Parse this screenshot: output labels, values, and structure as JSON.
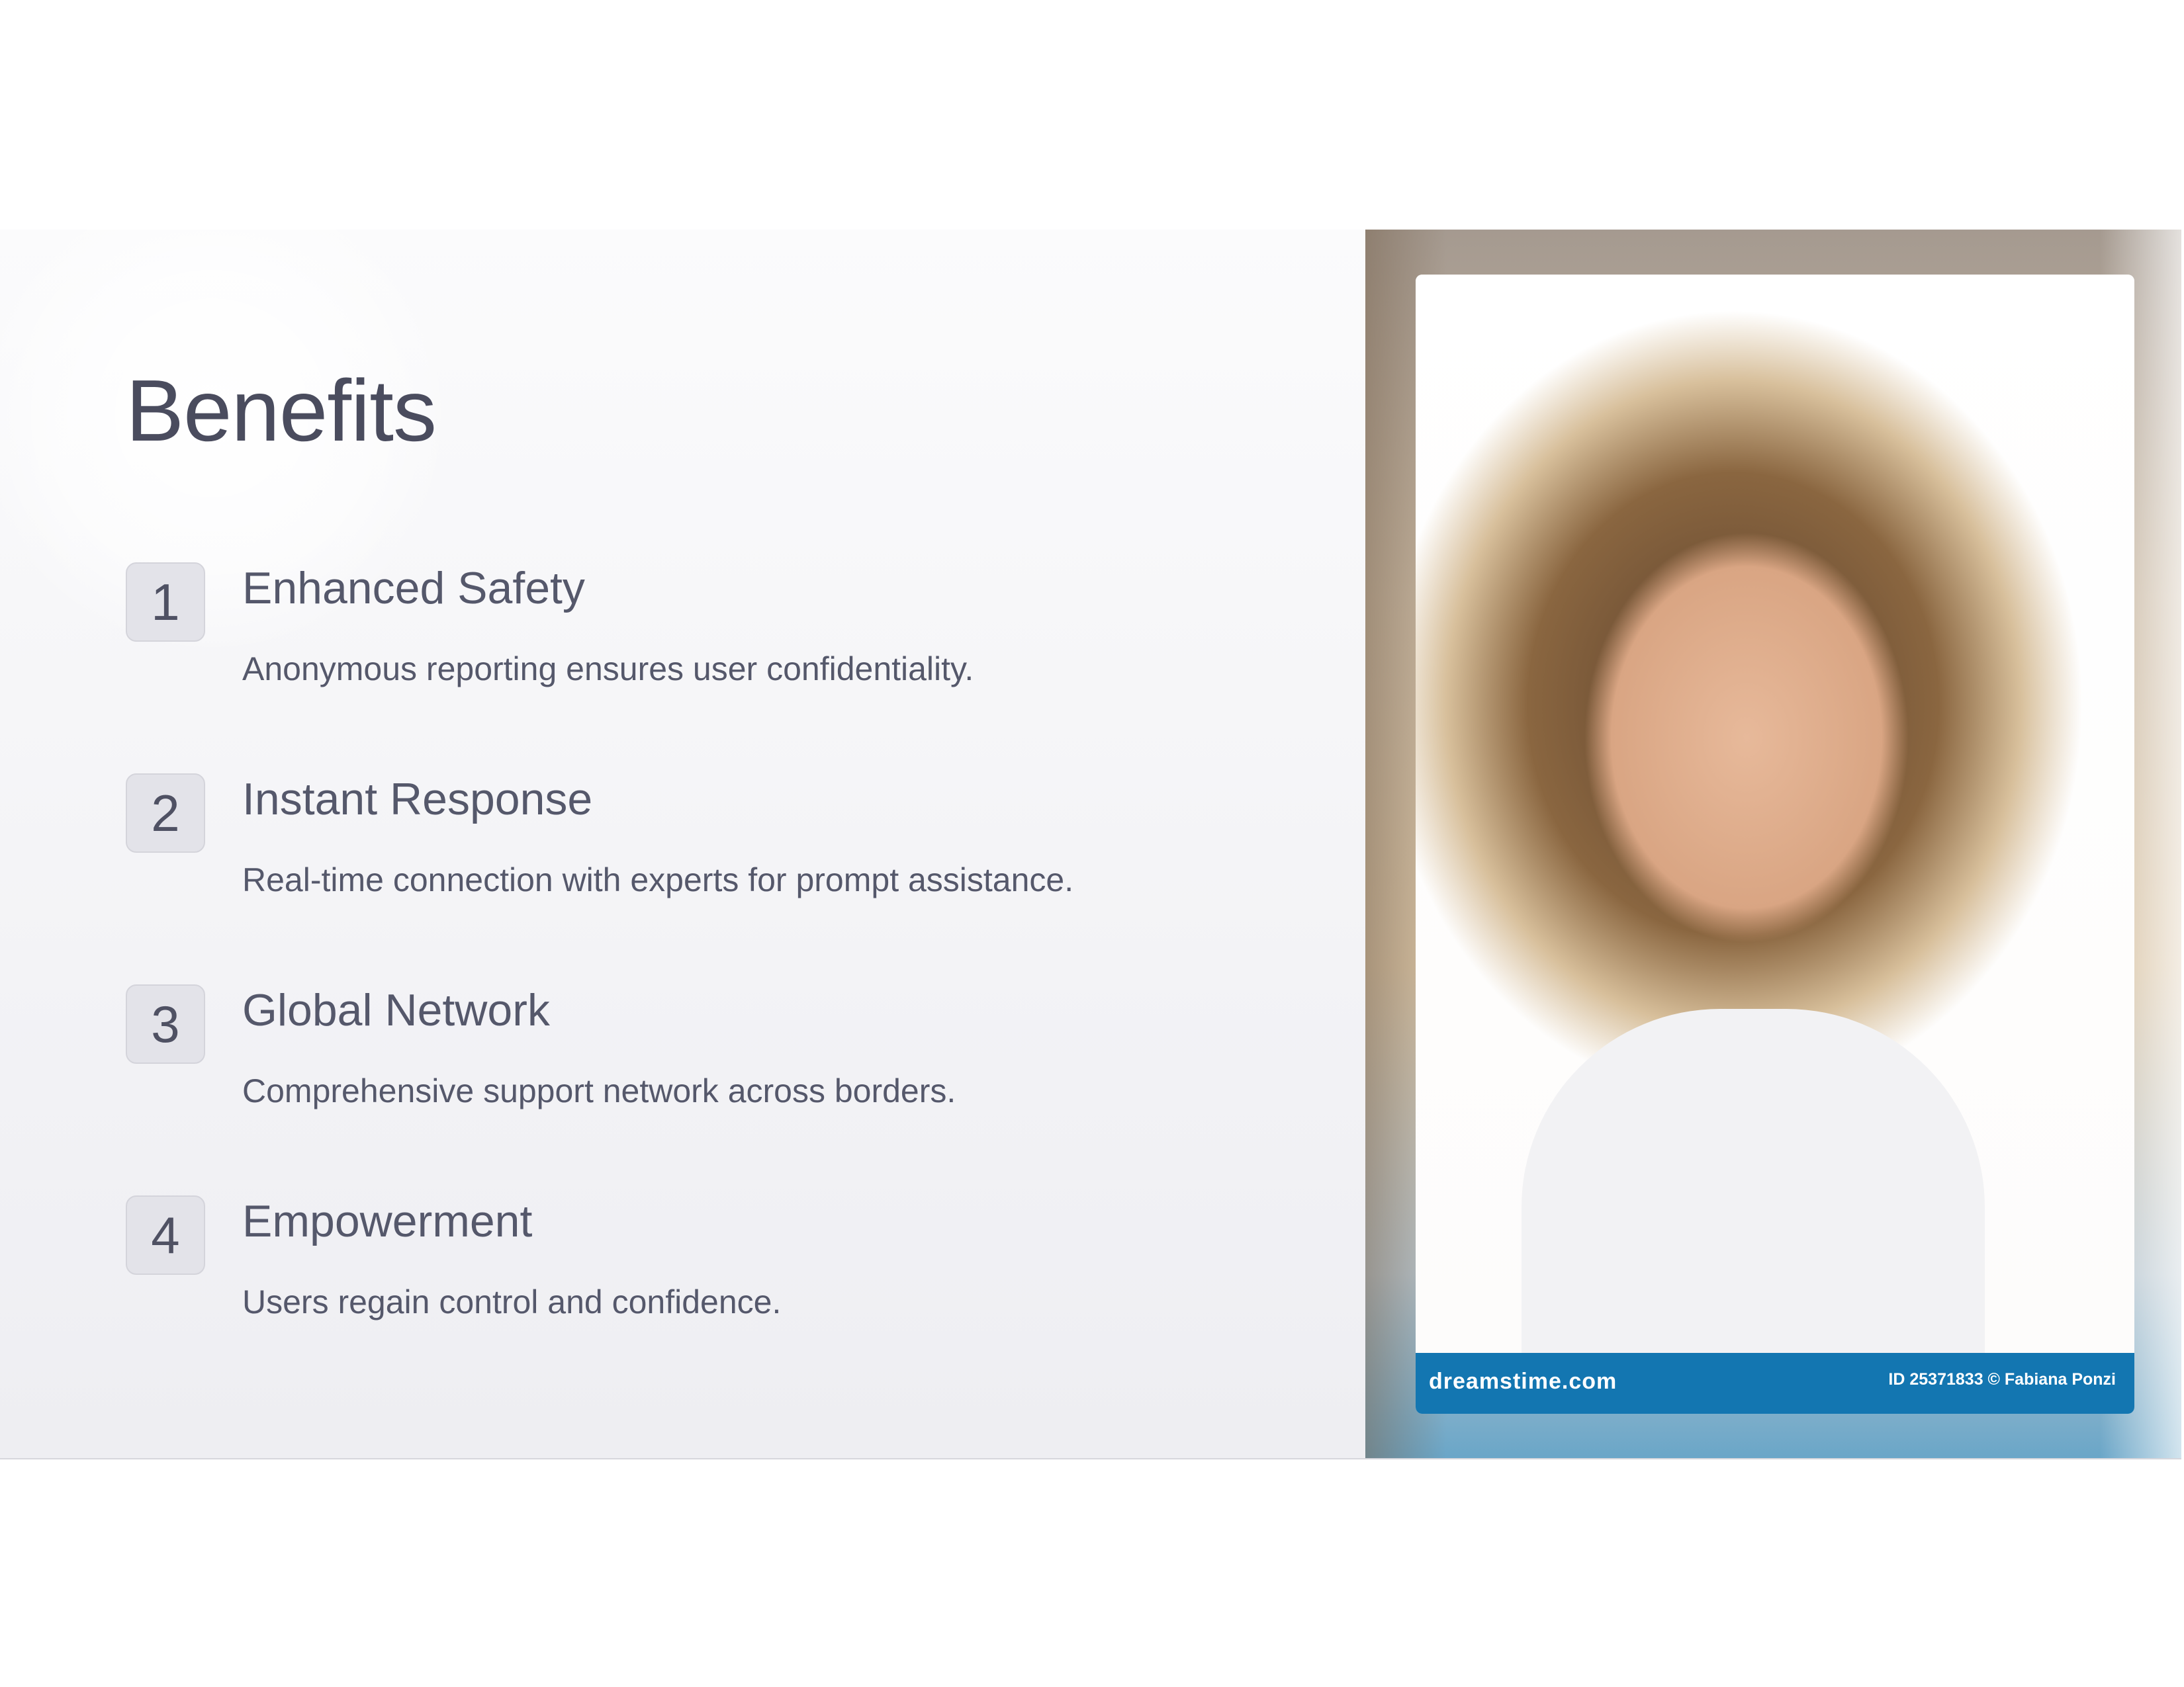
{
  "title": "Benefits",
  "items": [
    {
      "number": "1",
      "heading": "Enhanced Safety",
      "description": "Anonymous reporting ensures user confidentiality."
    },
    {
      "number": "2",
      "heading": "Instant Response",
      "description": "Real-time connection with experts for prompt assistance."
    },
    {
      "number": "3",
      "heading": "Global Network",
      "description": "Comprehensive support network across borders."
    },
    {
      "number": "4",
      "heading": "Empowerment",
      "description": "Users regain control and confidence."
    }
  ],
  "photo": {
    "watermark_logo": "dreamstime.com",
    "credit": "ID 25371833 © Fabiana Ponzi"
  }
}
